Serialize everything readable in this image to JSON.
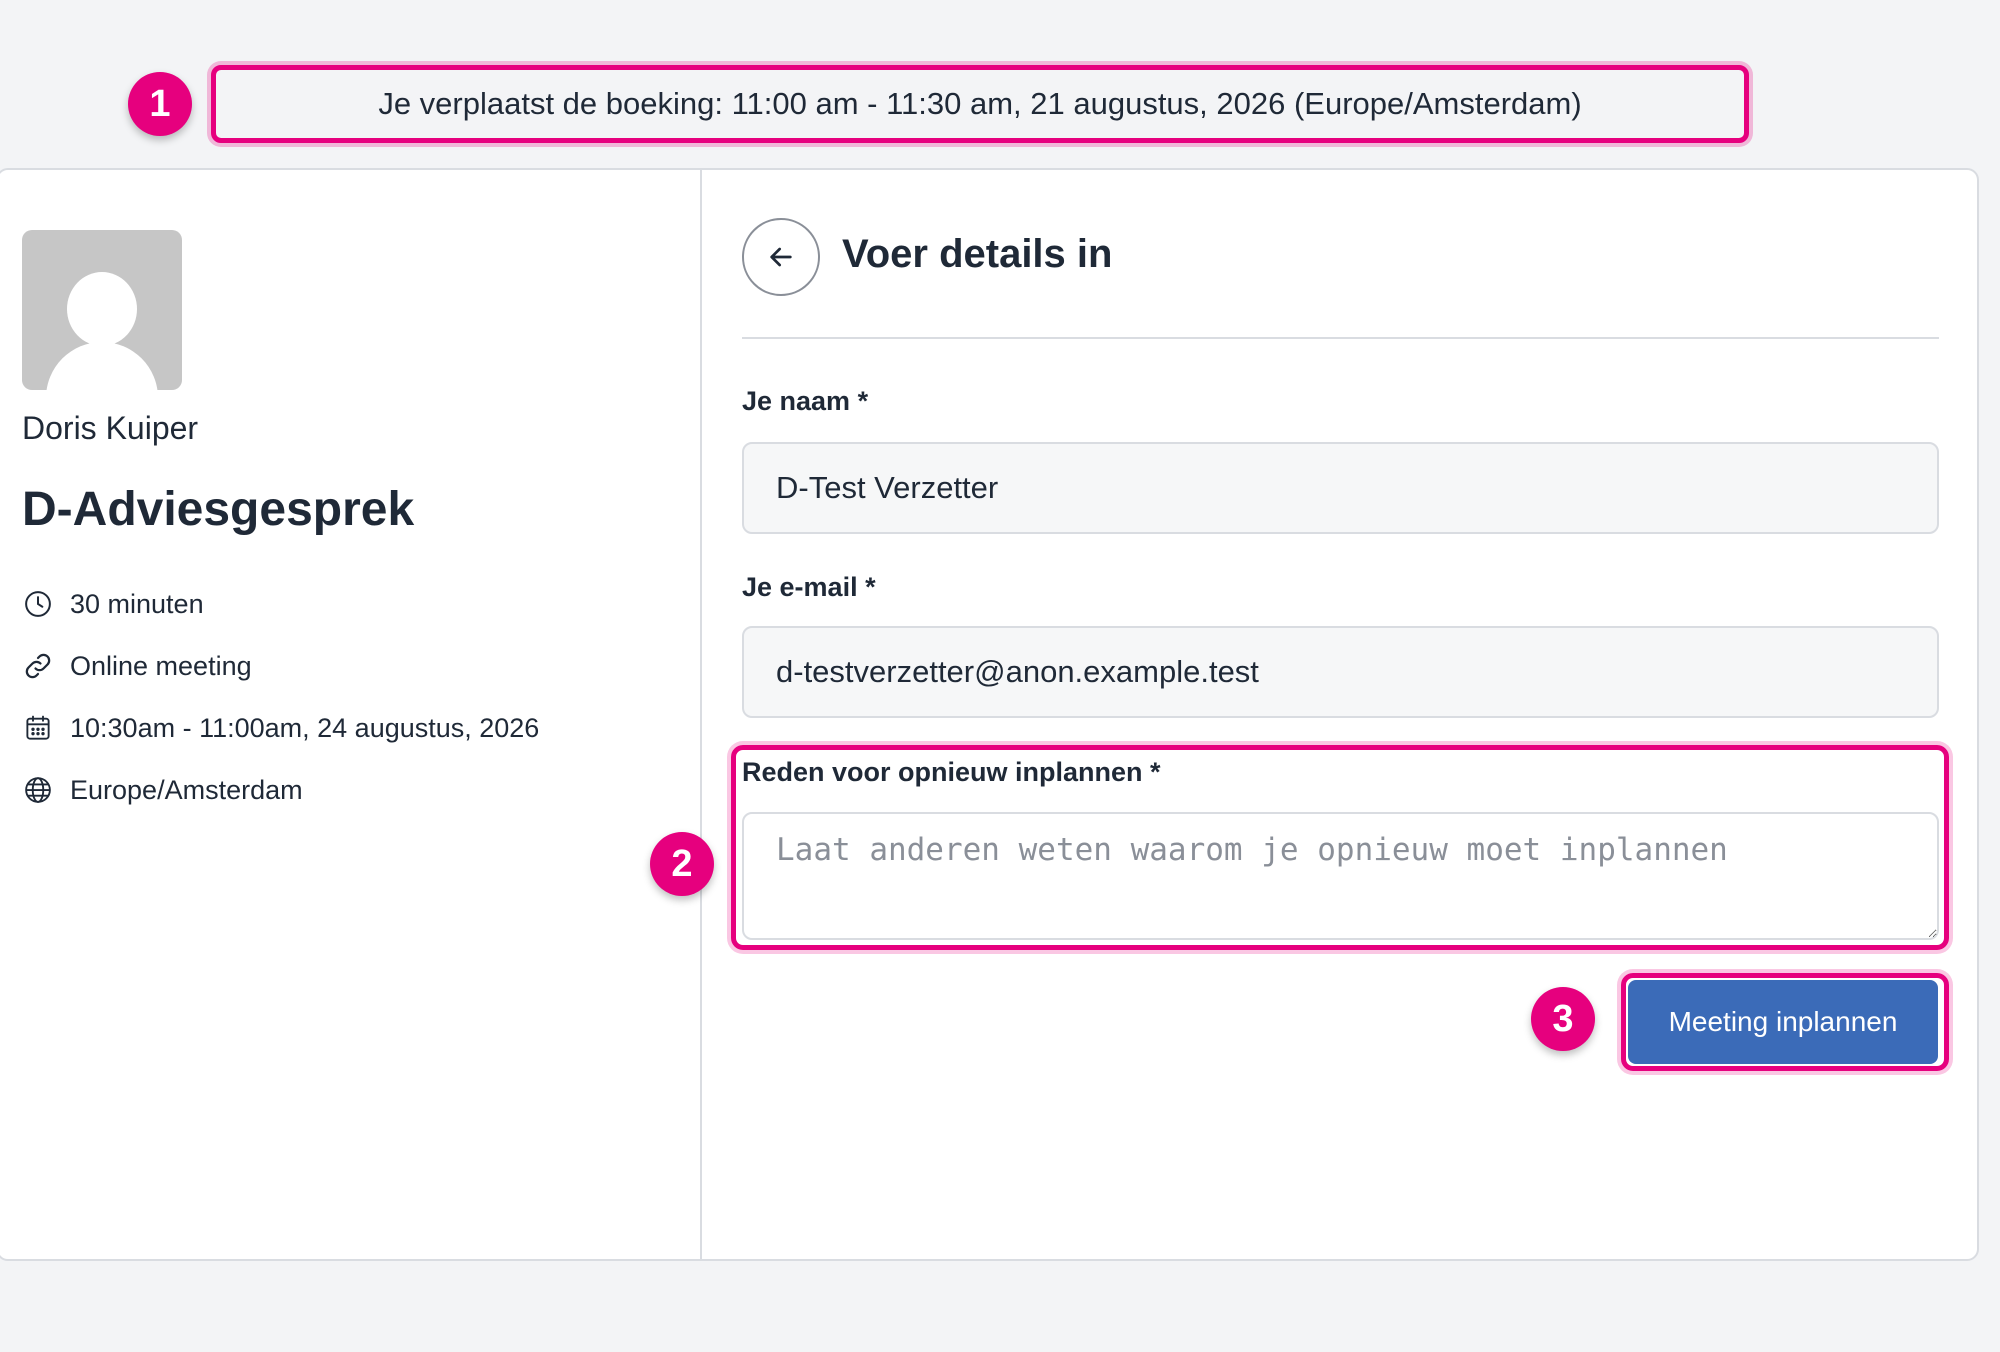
{
  "banner": {
    "text": "Je verplaatst de boeking: 11:00 am - 11:30 am, 21 augustus, 2026 (Europe/Amsterdam)"
  },
  "annotations": {
    "step1": "1",
    "step2": "2",
    "step3": "3",
    "color": "#e6007e"
  },
  "event": {
    "host": "Doris Kuiper",
    "title": "D-Adviesgesprek",
    "duration": "30 minuten",
    "location": "Online meeting",
    "time": "10:30am - 11:00am, 24 augustus, 2026",
    "timezone": "Europe/Amsterdam",
    "icons": [
      "clock-icon",
      "link-icon",
      "calendar-icon",
      "globe-icon"
    ]
  },
  "form": {
    "title": "Voer details in",
    "name_label": "Je naam *",
    "name_value": "D-Test Verzetter",
    "email_label": "Je e-mail *",
    "email_value": "d-testverzetter@anon.example.test",
    "reason_label": "Reden voor opnieuw inplannen *",
    "reason_placeholder": "Laat anderen weten waarom je opnieuw moet inplannen",
    "submit_label": "Meeting inplannen"
  },
  "colors": {
    "primary": "#3b6bb8",
    "highlight": "#e6007e"
  }
}
